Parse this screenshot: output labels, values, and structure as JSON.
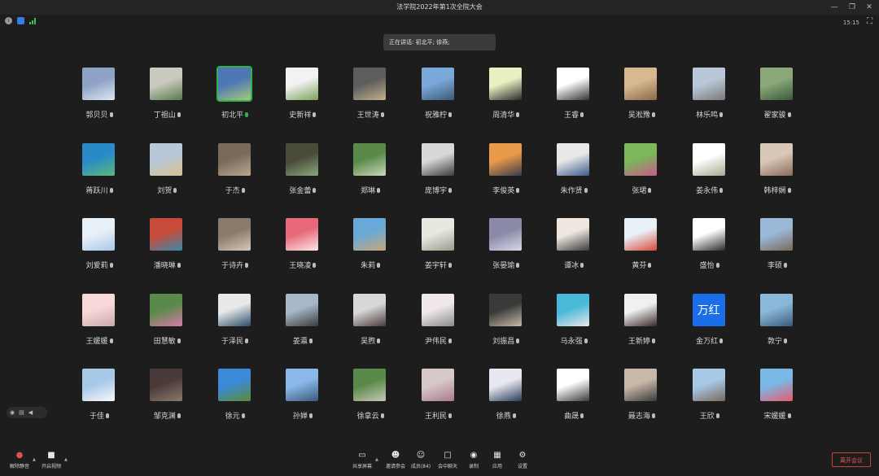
{
  "window": {
    "title": "法学院2022年第1次全院大会"
  },
  "status": {
    "clock": "15:15"
  },
  "speaking_banner": "正在讲话: 初北平; 徐燕;",
  "participants": [
    {
      "name": "郭贝贝",
      "colors": [
        "#8ea2c6",
        "#dfe6f2"
      ]
    },
    {
      "name": "丁祖山",
      "colors": [
        "#c9c9c0",
        "#5a7a4a"
      ]
    },
    {
      "name": "初北平",
      "colors": [
        "#4f77b5",
        "#a9c97a"
      ],
      "active": true
    },
    {
      "name": "史新祥",
      "colors": [
        "#f2f2f2",
        "#7aa25a"
      ]
    },
    {
      "name": "王世涛",
      "colors": [
        "#5d5d5d",
        "#c2b08a"
      ]
    },
    {
      "name": "祝雅柠",
      "colors": [
        "#7aa8d8",
        "#3c5a7a"
      ]
    },
    {
      "name": "周清华",
      "colors": [
        "#e8f0c0",
        "#2a2a2a"
      ]
    },
    {
      "name": "王睿",
      "colors": [
        "#ffffff",
        "#333333"
      ]
    },
    {
      "name": "吴淞豫",
      "colors": [
        "#d8b890",
        "#8a6a48"
      ]
    },
    {
      "name": "林乐鸣",
      "colors": [
        "#b8c8d8",
        "#7a7a7a"
      ]
    },
    {
      "name": "翟家骏",
      "colors": [
        "#8aa87a",
        "#3a5a3a"
      ]
    },
    {
      "name": "蒋跃川",
      "colors": [
        "#2a8ac8",
        "#5ab87a"
      ]
    },
    {
      "name": "刘贺",
      "colors": [
        "#b8c8d8",
        "#d8c090"
      ]
    },
    {
      "name": "于杰",
      "colors": [
        "#7a6a5a",
        "#b8a890"
      ]
    },
    {
      "name": "张金蕾",
      "colors": [
        "#4a4a3a",
        "#8aa87a"
      ]
    },
    {
      "name": "郑琳",
      "colors": [
        "#5a8a4a",
        "#c8d8b8"
      ]
    },
    {
      "name": "庞博宇",
      "colors": [
        "#d8d8d8",
        "#3a3a3a"
      ]
    },
    {
      "name": "李俊英",
      "colors": [
        "#e89a4a",
        "#3a3a4a"
      ]
    },
    {
      "name": "朱作贤",
      "colors": [
        "#e8e8e8",
        "#3a5a8a"
      ]
    },
    {
      "name": "张珺",
      "colors": [
        "#7ab85a",
        "#c85a8a"
      ]
    },
    {
      "name": "姜永伟",
      "colors": [
        "#ffffff",
        "#a8a890"
      ]
    },
    {
      "name": "韩梓娴",
      "colors": [
        "#d8c8b8",
        "#8a6a5a"
      ]
    },
    {
      "name": "刘爱莉",
      "colors": [
        "#e8f0f8",
        "#a8c8e8"
      ]
    },
    {
      "name": "潘晓琳",
      "colors": [
        "#c84a3a",
        "#3a8aa8"
      ]
    },
    {
      "name": "于诗卉",
      "colors": [
        "#8a7a6a",
        "#d8c8b8"
      ]
    },
    {
      "name": "王晓凌",
      "colors": [
        "#e86a7a",
        "#f8e8e8"
      ]
    },
    {
      "name": "朱莉",
      "colors": [
        "#6aa8d8",
        "#c8a878"
      ]
    },
    {
      "name": "姜宇轩",
      "colors": [
        "#e8e8e0",
        "#9a9a8a"
      ]
    },
    {
      "name": "张晏瑜",
      "colors": [
        "#8a8aa8",
        "#d8d8e8"
      ]
    },
    {
      "name": "谭冰",
      "colors": [
        "#f0e8e0",
        "#3a3a3a"
      ]
    },
    {
      "name": "黄芬",
      "colors": [
        "#e8f0f8",
        "#d84a3a"
      ]
    },
    {
      "name": "盛怡",
      "colors": [
        "#ffffff",
        "#2a2a2a"
      ]
    },
    {
      "name": "李硕",
      "colors": [
        "#9ab8d8",
        "#7a6a5a"
      ]
    },
    {
      "name": "王媛媛",
      "colors": [
        "#f8d8d8",
        "#c8a8a8"
      ]
    },
    {
      "name": "田慧敏",
      "colors": [
        "#5a8a4a",
        "#d87aa8"
      ]
    },
    {
      "name": "于泽民",
      "colors": [
        "#e8e8e8",
        "#2a4a6a"
      ]
    },
    {
      "name": "姜瀛",
      "colors": [
        "#a8b8c8",
        "#3a3a3a"
      ]
    },
    {
      "name": "吴煦",
      "colors": [
        "#d8d8d8",
        "#4a3a3a"
      ]
    },
    {
      "name": "尹伟民",
      "colors": [
        "#f0e8e8",
        "#8a8a8a"
      ]
    },
    {
      "name": "刘振昌",
      "colors": [
        "#3a3a3a",
        "#c8b8a8"
      ]
    },
    {
      "name": "马永强",
      "colors": [
        "#4ab8d8",
        "#e8e8e8"
      ]
    },
    {
      "name": "王新婷",
      "colors": [
        "#f0f0f0",
        "#3a2a2a"
      ]
    },
    {
      "name": "金万红",
      "colors": [
        "#1a6fe8",
        "#1a6fe8"
      ],
      "text": "万红"
    },
    {
      "name": "敦宁",
      "colors": [
        "#8ab8d8",
        "#3a5a7a"
      ]
    },
    {
      "name": "于佳",
      "colors": [
        "#a8c8e8",
        "#f8f8f8"
      ]
    },
    {
      "name": "邹克渊",
      "colors": [
        "#4a3a3a",
        "#8a7a6a"
      ]
    },
    {
      "name": "徐元",
      "colors": [
        "#3a8ad8",
        "#5a8a3a"
      ]
    },
    {
      "name": "孙婵",
      "colors": [
        "#8ab8e8",
        "#3a5a7a"
      ]
    },
    {
      "name": "徐拿云",
      "colors": [
        "#5a8a4a",
        "#c8c8b8"
      ]
    },
    {
      "name": "王利民",
      "colors": [
        "#d8c8c8",
        "#a87a8a"
      ]
    },
    {
      "name": "徐燕",
      "colors": [
        "#e8e8f0",
        "#2a3a5a"
      ]
    },
    {
      "name": "曲晟",
      "colors": [
        "#ffffff",
        "#3a3a3a"
      ]
    },
    {
      "name": "聂志海",
      "colors": [
        "#c8b8a8",
        "#3a3a3a"
      ]
    },
    {
      "name": "王欣",
      "colors": [
        "#a8c8e8",
        "#7a6a5a"
      ]
    },
    {
      "name": "宋媛媛",
      "colors": [
        "#7ab8e8",
        "#e85a6a"
      ]
    }
  ],
  "toolbar": {
    "mute": "解除静音",
    "video": "开启视频",
    "share": "共享屏幕",
    "invite": "邀请参会",
    "members": "成员(84)",
    "chat": "会中聊天",
    "record": "录制",
    "apps": "应用",
    "settings": "设置",
    "leave": "离开会议"
  }
}
